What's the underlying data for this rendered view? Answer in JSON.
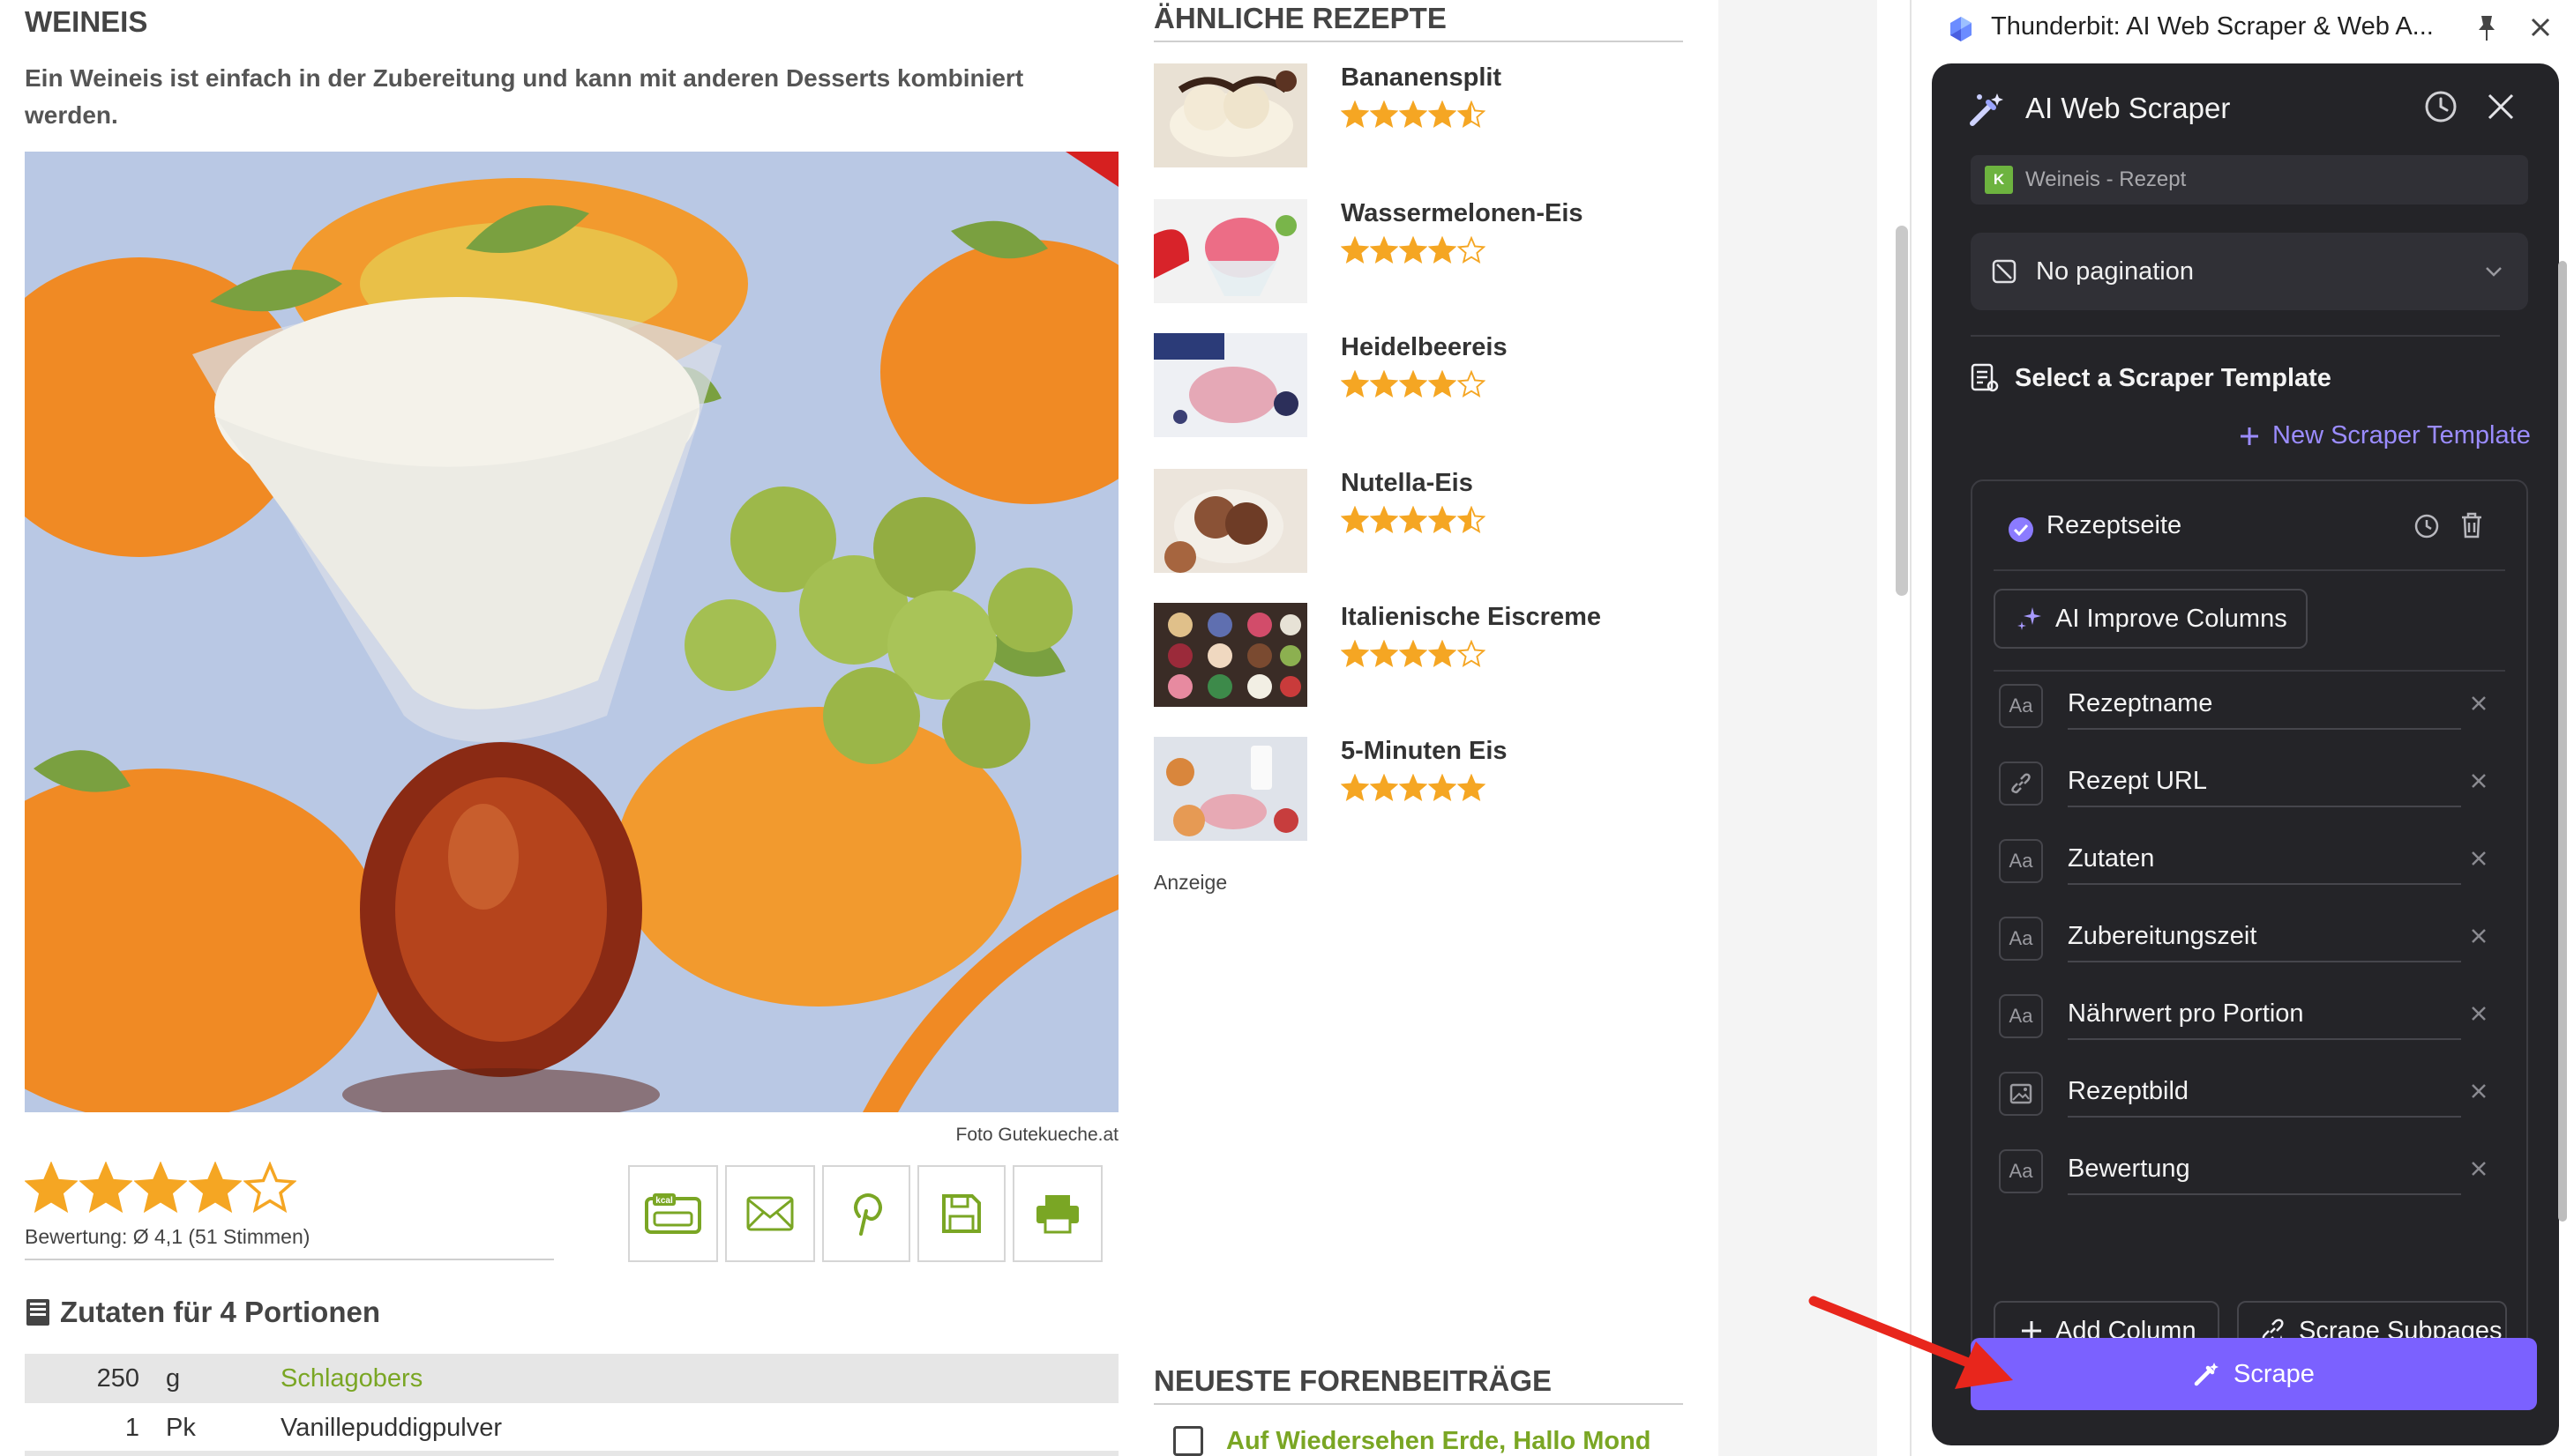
{
  "recipe": {
    "title": "WEINEIS",
    "description": "Ein Weineis ist einfach in der Zubereitung und kann mit anderen Desserts kombiniert werden.",
    "photo_credit": "Foto Gutekueche.at",
    "rating_stars": 4.1,
    "rating_text": "Bewertung: Ø 4,1 (51 Stimmen)",
    "ingredients_heading": "Zutaten für 4 Portionen",
    "ingredients": [
      {
        "amount": "250",
        "unit": "g",
        "name": "Schlagobers",
        "link": true
      },
      {
        "amount": "1",
        "unit": "Pk",
        "name": "Vanillepuddigpulver",
        "link": false
      }
    ],
    "action_icons": [
      "kcal-calculator-icon",
      "mail-icon",
      "pinterest-icon",
      "save-icon",
      "print-icon"
    ]
  },
  "similar": {
    "heading": "ÄHNLICHE REZEPTE",
    "items": [
      {
        "name": "Bananensplit",
        "stars": 4.5
      },
      {
        "name": "Wassermelonen-Eis",
        "stars": 4
      },
      {
        "name": "Heidelbeereis",
        "stars": 4
      },
      {
        "name": "Nutella-Eis",
        "stars": 4.5
      },
      {
        "name": "Italienische Eiscreme",
        "stars": 4
      },
      {
        "name": "5-Minuten Eis",
        "stars": 5
      }
    ],
    "ad_label": "Anzeige"
  },
  "forum": {
    "heading": "NEUESTE FORENBEITRÄGE",
    "first_post": "Auf Wiedersehen Erde, Hallo Mond"
  },
  "extension": {
    "window_title": "Thunderbit: AI Web Scraper & Web A...",
    "panel_title": "AI Web Scraper",
    "page_chip": "Weineis - Rezept",
    "pagination": "No pagination",
    "template_heading": "Select a Scraper Template",
    "new_template": "New Scraper Template",
    "template_name": "Rezeptseite",
    "ai_improve": "AI Improve Columns",
    "columns": [
      {
        "name": "Rezeptname",
        "type": "text"
      },
      {
        "name": "Rezept URL",
        "type": "url"
      },
      {
        "name": "Zutaten",
        "type": "text"
      },
      {
        "name": "Zubereitungszeit",
        "type": "text"
      },
      {
        "name": "Nährwert pro Portion",
        "type": "text"
      },
      {
        "name": "Rezeptbild",
        "type": "image"
      },
      {
        "name": "Bewertung",
        "type": "text"
      }
    ],
    "add_column": "Add Column",
    "scrape_subpages": "Scrape Subpages",
    "scrape_button": "Scrape"
  },
  "colors": {
    "accent": "#7b61ff",
    "star": "#f5a623",
    "link_green": "#7aa624",
    "panel_bg": "#242428"
  }
}
